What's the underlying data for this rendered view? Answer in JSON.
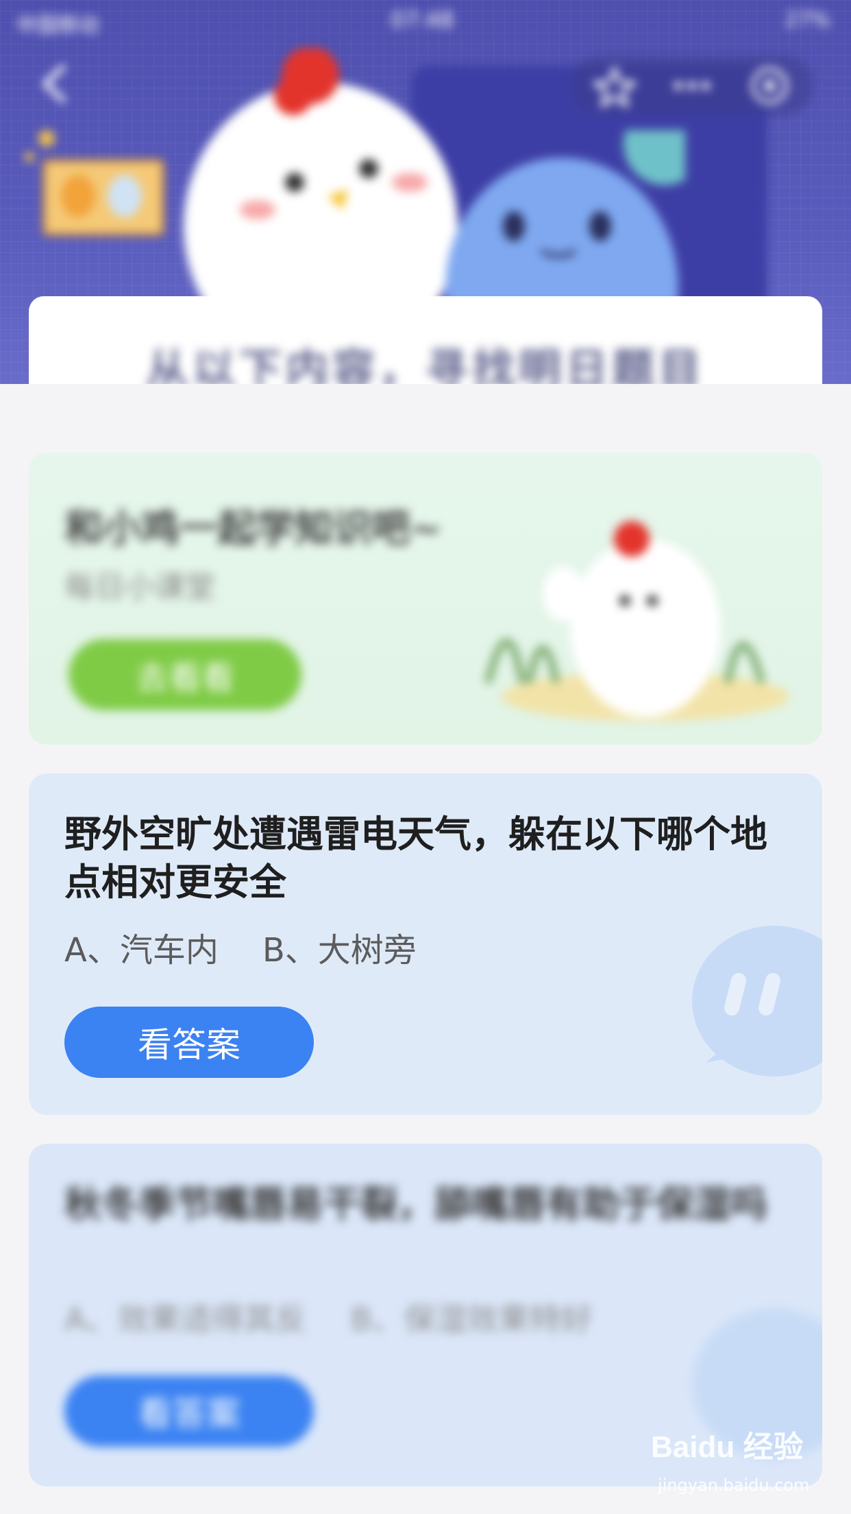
{
  "status_bar": {
    "carrier": "中国移动",
    "time": "07:48",
    "battery": "27%"
  },
  "header": {
    "banner_title": "从以下内容，寻找明日题目"
  },
  "learn_card": {
    "title": "和小鸡一起学知识吧~",
    "subtitle": "每日小课堂",
    "button_label": "去看看"
  },
  "question_card": {
    "title": "野外空旷处遭遇雷电天气，躲在以下哪个地点相对更安全",
    "option_a": "A、汽车内",
    "option_b": "B、大树旁",
    "button_label": "看答案"
  },
  "question_card_2": {
    "title": "秋冬季节嘴唇易干裂，舔嘴唇有助于保湿吗",
    "option_a": "A、效果适得其反",
    "option_b": "B、保湿效果特好",
    "button_label": "看答案"
  },
  "watermark": {
    "brand": "Baidu 经验",
    "url": "jingyan.baidu.com"
  },
  "colors": {
    "header_bg": "#5a5cbd",
    "primary_button": "#3b82f2",
    "green_button": "#7fcb46",
    "question_card_bg": "#dfeaf9",
    "learn_card_bg": "#e3f5e8"
  }
}
